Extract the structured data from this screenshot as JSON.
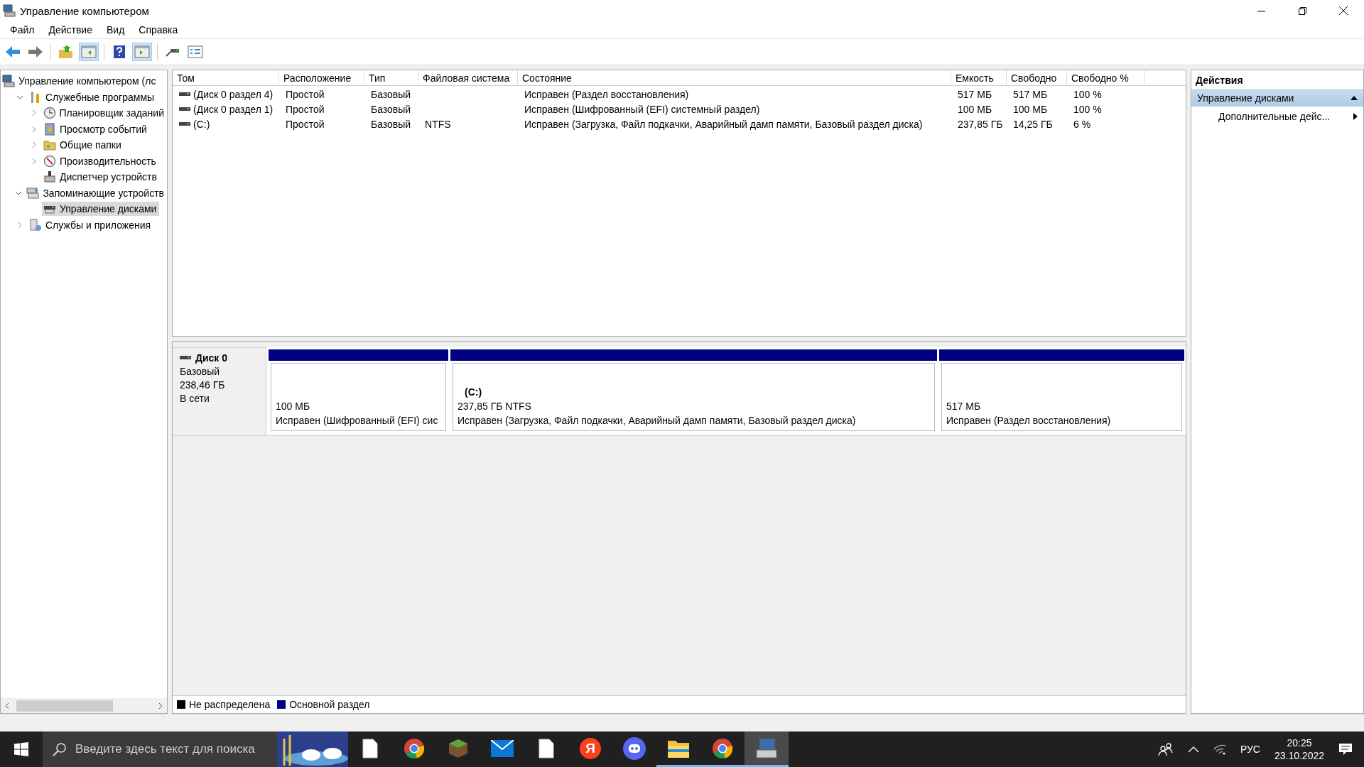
{
  "window": {
    "title": "Управление компьютером"
  },
  "menu": [
    "Файл",
    "Действие",
    "Вид",
    "Справка"
  ],
  "toolbar": [
    {
      "kind": "back"
    },
    {
      "kind": "forward"
    },
    {
      "kind": "separator"
    },
    {
      "kind": "up"
    },
    {
      "kind": "console-tree",
      "pressed": true
    },
    {
      "kind": "separator"
    },
    {
      "kind": "help"
    },
    {
      "kind": "action-pane",
      "pressed": true
    },
    {
      "kind": "separator"
    },
    {
      "kind": "connect"
    },
    {
      "kind": "properties"
    }
  ],
  "tree": [
    {
      "label": "Управление компьютером (лс",
      "selected": false,
      "children": [
        {
          "label": "Служебные программы",
          "expanded": true,
          "selected": false,
          "children": [
            {
              "label": "Планировщик заданий",
              "expanded": false,
              "selected": false
            },
            {
              "label": "Просмотр событий",
              "expanded": false,
              "selected": false
            },
            {
              "label": "Общие папки",
              "expanded": false,
              "selected": false
            },
            {
              "label": "Производительность",
              "expanded": false,
              "selected": false
            },
            {
              "label": "Диспетчер устройств",
              "selected": false
            }
          ]
        },
        {
          "label": "Запоминающие устройств",
          "expanded": true,
          "selected": false,
          "children": [
            {
              "label": "Управление дисками",
              "selected": true
            }
          ]
        },
        {
          "label": "Службы и приложения",
          "expanded": false,
          "selected": false
        }
      ]
    }
  ],
  "table": {
    "columns": [
      "Том",
      "Расположение",
      "Тип",
      "Файловая система",
      "Состояние",
      "Емкость",
      "Свободно",
      "Свободно %"
    ],
    "rows": [
      [
        "(Диск 0 раздел 4)",
        "Простой",
        "Базовый",
        "",
        "Исправен (Раздел восстановления)",
        "517 МБ",
        "517 МБ",
        "100 %"
      ],
      [
        "(Диск 0 раздел 1)",
        "Простой",
        "Базовый",
        "",
        "Исправен (Шифрованный (EFI) системный раздел)",
        "100 МБ",
        "100 МБ",
        "100 %"
      ],
      [
        "(C:)",
        "Простой",
        "Базовый",
        "NTFS",
        "Исправен (Загрузка, Файл подкачки, Аварийный дамп памяти, Базовый раздел диска)",
        "237,85 ГБ",
        "14,25 ГБ",
        "6 %"
      ]
    ]
  },
  "disks": [
    {
      "name": "Диск 0",
      "type": "Базовый",
      "size": "238,46 ГБ",
      "status": "В сети",
      "partitions": [
        {
          "size": "100 МБ",
          "status": "Исправен (Шифрованный (EFI) сис",
          "color": "#000080"
        },
        {
          "name": "(C:)",
          "size": "237,85 ГБ NTFS",
          "status": "Исправен (Загрузка, Файл подкачки, Аварийный дамп памяти, Базовый раздел диска)",
          "color": "#000080"
        },
        {
          "size": "517 МБ",
          "status": "Исправен (Раздел восстановления)",
          "color": "#000080"
        }
      ]
    }
  ],
  "legend": [
    {
      "label": "Не распределена",
      "color": "#000000"
    },
    {
      "label": "Основной раздел",
      "color": "#000080"
    }
  ],
  "actions": {
    "title": "Действия",
    "section": "Управление дисками",
    "expanded": true,
    "items": [
      "Дополнительные дейс..."
    ]
  },
  "taskbar": {
    "search_placeholder": "Введите здесь текст для поиска",
    "apps": [
      {
        "kind": "file",
        "running": false,
        "selected": false
      },
      {
        "kind": "chrome",
        "running": false,
        "selected": false
      },
      {
        "kind": "grass-block",
        "running": false,
        "selected": false
      },
      {
        "kind": "mail",
        "running": false,
        "selected": false
      },
      {
        "kind": "file",
        "running": false,
        "selected": false
      },
      {
        "kind": "yandex",
        "glyph": "Я",
        "running": false,
        "selected": false
      },
      {
        "kind": "discord",
        "running": false,
        "selected": false
      },
      {
        "kind": "explorer",
        "running": true,
        "selected": false
      },
      {
        "kind": "chrome",
        "running": true,
        "selected": false
      },
      {
        "kind": "computer",
        "running": true,
        "selected": true
      }
    ],
    "language": "РУС",
    "time": "20:25",
    "date": "23.10.2022"
  }
}
